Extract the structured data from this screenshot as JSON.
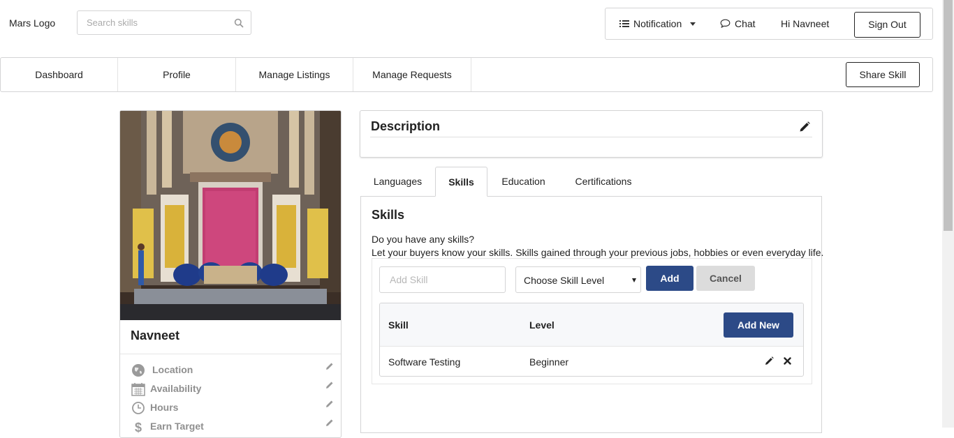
{
  "header": {
    "logo": "Mars Logo",
    "search_placeholder": "Search skills",
    "notification": "Notification",
    "chat": "Chat",
    "greeting": "Hi Navneet",
    "signout": "Sign Out"
  },
  "nav": {
    "items": [
      {
        "label": "Dashboard"
      },
      {
        "label": "Profile"
      },
      {
        "label": "Manage Listings"
      },
      {
        "label": "Manage Requests"
      }
    ],
    "share": "Share Skill"
  },
  "profile": {
    "name": "Navneet",
    "fields": [
      {
        "label": "Location",
        "icon": "globe-icon"
      },
      {
        "label": "Availability",
        "icon": "calendar-icon"
      },
      {
        "label": "Hours",
        "icon": "clock-icon"
      },
      {
        "label": "Earn Target",
        "icon": "dollar-icon"
      }
    ]
  },
  "description": {
    "title": "Description"
  },
  "tabs": [
    {
      "label": "Languages"
    },
    {
      "label": "Skills",
      "active": true
    },
    {
      "label": "Education"
    },
    {
      "label": "Certifications"
    }
  ],
  "skills": {
    "title": "Skills",
    "question": "Do you have any skills?",
    "prompt": "Let your buyers know your skills. Skills gained through your previous jobs, hobbies or even everyday life.",
    "add_placeholder": "Add Skill",
    "level_selected": "Choose Skill Level",
    "add_button": "Add",
    "cancel_button": "Cancel",
    "table": {
      "col_skill": "Skill",
      "col_level": "Level",
      "add_new": "Add New",
      "rows": [
        {
          "skill": "Software Testing",
          "level": "Beginner"
        }
      ]
    }
  },
  "colors": {
    "primary": "#2c4a87",
    "cancel": "#dcdcdc",
    "border": "#d4d4d5"
  }
}
